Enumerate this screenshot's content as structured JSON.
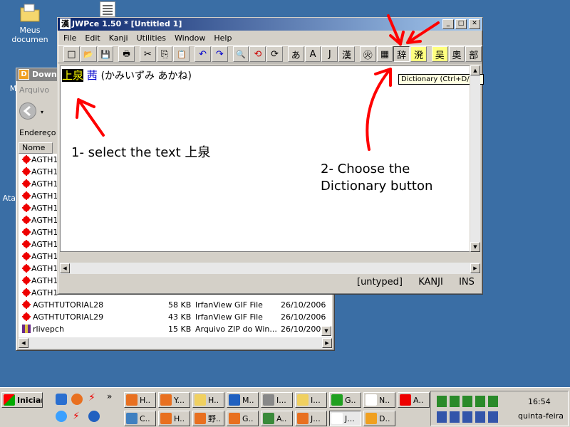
{
  "desktop": {
    "icons": [
      {
        "label": "Meus documen"
      },
      {
        "label": "Me"
      },
      {
        "label": "Ata"
      }
    ]
  },
  "explorer": {
    "title": "Down",
    "menu_first": "Arquivo",
    "address_label": "Endereço",
    "column_name": "Nome",
    "partial_rows": [
      "AGTH1",
      "AGTH1",
      "AGTH1",
      "AGTH1",
      "AGTH1",
      "AGTH1",
      "AGTH1",
      "AGTH1",
      "AGTH1",
      "AGTH1",
      "AGTH1",
      "AGTH1"
    ],
    "rows": [
      {
        "name": "AGTHTUTORIAL28",
        "size": "58 KB",
        "type": "IrfanView GIF File",
        "date": "26/10/2006"
      },
      {
        "name": "AGTHTUTORIAL29",
        "size": "43 KB",
        "type": "IrfanView GIF File",
        "date": "26/10/2006"
      },
      {
        "name": "rlivepch",
        "size": "15 KB",
        "type": "Arquivo ZIP do Win...",
        "date": "26/10/2006"
      }
    ]
  },
  "jwpce": {
    "title": "JWPce 1.50 * [Untitled 1]",
    "menu": [
      "File",
      "Edit",
      "Kanji",
      "Utilities",
      "Window",
      "Help"
    ],
    "toolbar_glyphs": [
      "□",
      "📂",
      "💾",
      "🖶",
      "✂",
      "⎘",
      "📋",
      "↶",
      "↷",
      "🔍",
      "⟲",
      "⟳",
      "あ",
      "A",
      "J",
      "漢",
      "㊋",
      "▦",
      "辞",
      "溌",
      "吴",
      "奧",
      "部"
    ],
    "editor_selected": "上泉",
    "editor_kanji": "茜",
    "editor_reading": "(かみいずみ あかね)",
    "tooltip": "Dictionary (Ctrl+D/F6)",
    "status": [
      "[untyped]",
      "KANJI",
      "INS"
    ]
  },
  "annotations": {
    "step1": "1- select the text 上泉",
    "step2_line1": "2- Choose the",
    "step2_line2": "Dictionary button"
  },
  "taskbar": {
    "start": "Iniciar",
    "clock": "16:54",
    "day": "quinta-feira",
    "tasks_top": [
      "H..",
      "Y...",
      "H..",
      "M..",
      "I...",
      "I...",
      "G..",
      "N..",
      "A.."
    ],
    "tasks_bottom": [
      "C..",
      "H..",
      "野..",
      "G..",
      "A..",
      "J...",
      "J...",
      "D.."
    ],
    "quicklaunch_more": "»"
  },
  "colors": {
    "desktop": "#3a6ea5",
    "selection_bg": "#000000",
    "selection_fg": "#ffff00",
    "kanji_blue": "#0000cc",
    "arrow_red": "#ff0000"
  }
}
